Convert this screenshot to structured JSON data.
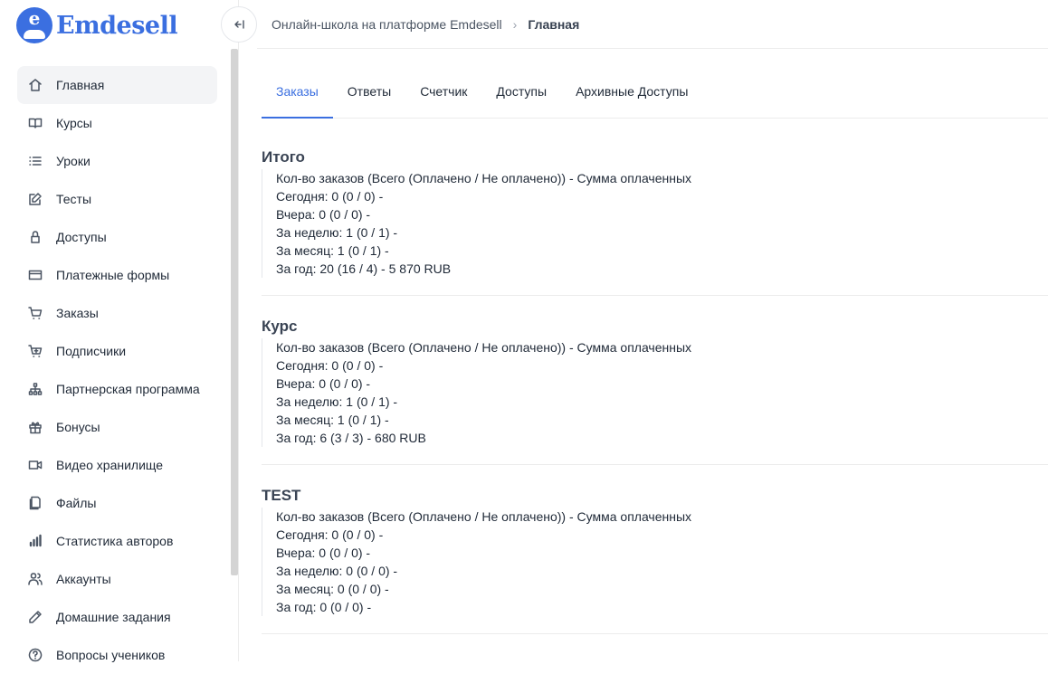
{
  "app": {
    "logo_text": "Emdesell",
    "logo_letter": "e"
  },
  "breadcrumb": [
    "Онлайн-школа на платформе Emdesell",
    "Главная"
  ],
  "sidebar": {
    "items": [
      {
        "label": "Главная",
        "icon": "home-icon",
        "active": true
      },
      {
        "label": "Курсы",
        "icon": "book-icon"
      },
      {
        "label": "Уроки",
        "icon": "list-icon"
      },
      {
        "label": "Тесты",
        "icon": "edit-icon"
      },
      {
        "label": "Доступы",
        "icon": "lock-icon"
      },
      {
        "label": "Платежные формы",
        "icon": "credit-card-icon"
      },
      {
        "label": "Заказы",
        "icon": "cart-icon"
      },
      {
        "label": "Подписчики",
        "icon": "cart-plus-icon"
      },
      {
        "label": "Партнерская программа",
        "icon": "hierarchy-icon"
      },
      {
        "label": "Бонусы",
        "icon": "gift-icon"
      },
      {
        "label": "Видео хранилище",
        "icon": "video-icon"
      },
      {
        "label": "Файлы",
        "icon": "files-icon"
      },
      {
        "label": "Статистика авторов",
        "icon": "bar-chart-icon"
      },
      {
        "label": "Аккаунты",
        "icon": "users-icon"
      },
      {
        "label": "Домашние задания",
        "icon": "pencil-icon"
      },
      {
        "label": "Вопросы учеников",
        "icon": "question-icon"
      }
    ]
  },
  "tabs": [
    {
      "label": "Заказы",
      "active": true
    },
    {
      "label": "Ответы"
    },
    {
      "label": "Счетчик"
    },
    {
      "label": "Доступы"
    },
    {
      "label": "Архивные Доступы"
    }
  ],
  "sections": [
    {
      "title": "Итого",
      "lines": [
        "Кол-во заказов (Всего (Оплачено / Не оплачено)) - Сумма оплаченных",
        "Сегодня: 0 (0 / 0) -",
        "Вчера: 0 (0 / 0) -",
        "За неделю: 1 (0 / 1) -",
        "За месяц: 1 (0 / 1) -",
        "За год: 20 (16 / 4) - 5 870 RUB"
      ]
    },
    {
      "title": "Курс",
      "lines": [
        "Кол-во заказов (Всего (Оплачено / Не оплачено)) - Сумма оплаченных",
        "Сегодня: 0 (0 / 0) -",
        "Вчера: 0 (0 / 0) -",
        "За неделю: 1 (0 / 1) -",
        "За месяц: 1 (0 / 1) -",
        "За год: 6 (3 / 3) - 680 RUB"
      ]
    },
    {
      "title": "TEST",
      "lines": [
        "Кол-во заказов (Всего (Оплачено / Не оплачено)) - Сумма оплаченных",
        "Сегодня: 0 (0 / 0) -",
        "Вчера: 0 (0 / 0) -",
        "За неделю: 0 (0 / 0) -",
        "За месяц: 0 (0 / 0) -",
        "За год: 0 (0 / 0) -"
      ]
    }
  ],
  "colors": {
    "accent": "#3b6fe0"
  }
}
